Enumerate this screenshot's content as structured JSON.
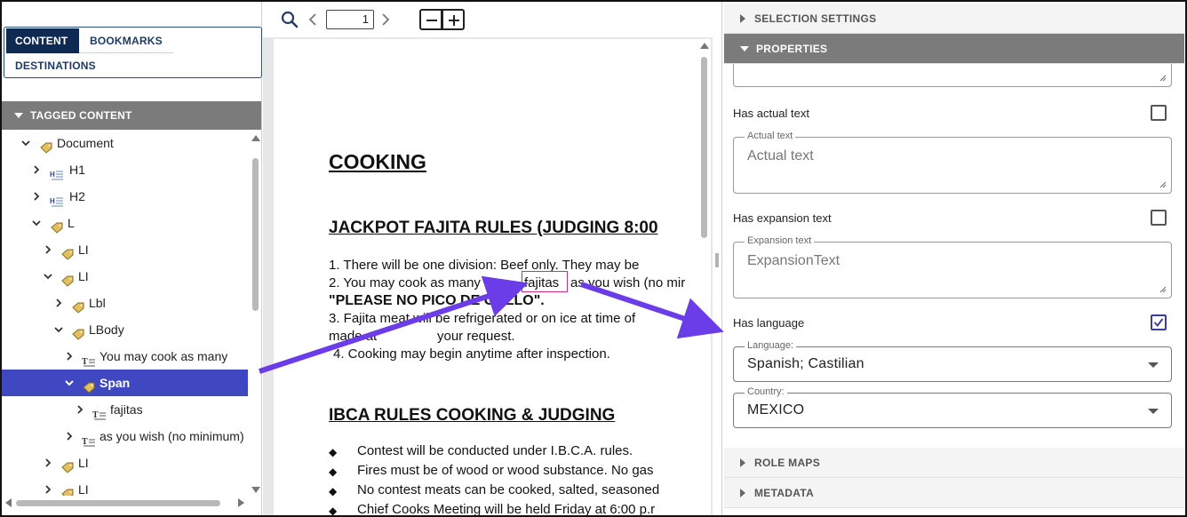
{
  "left_panel": {
    "tabs": [
      {
        "label": "CONTENT",
        "active": true
      },
      {
        "label": "BOOKMARKS",
        "active": false
      },
      {
        "label": "DESTINATIONS",
        "active": false
      }
    ],
    "section_title": "TAGGED CONTENT",
    "tree": [
      {
        "label": "Document",
        "icon": "tag-icon",
        "expanded": true
      },
      {
        "label": "H1",
        "icon": "heading-icon",
        "expanded": false
      },
      {
        "label": "H2",
        "icon": "heading-icon",
        "expanded": false
      },
      {
        "label": "L",
        "icon": "tag-icon",
        "expanded": true
      },
      {
        "label": "LI",
        "icon": "tag-icon",
        "expanded": false
      },
      {
        "label": "LI",
        "icon": "tag-icon",
        "expanded": true
      },
      {
        "label": "Lbl",
        "icon": "tag-icon",
        "expanded": false
      },
      {
        "label": "LBody",
        "icon": "tag-icon",
        "expanded": true
      },
      {
        "label": "You may cook as many",
        "icon": "text-icon",
        "expanded": false
      },
      {
        "label": "Span",
        "icon": "tag-icon",
        "expanded": true,
        "selected": true
      },
      {
        "label": "fajitas",
        "icon": "text-icon",
        "expanded": false
      },
      {
        "label": "as you wish (no minimum)",
        "icon": "text-icon",
        "expanded": false
      },
      {
        "label": "LI",
        "icon": "tag-icon",
        "expanded": false
      },
      {
        "label": "LI",
        "icon": "tag-icon",
        "expanded": false
      }
    ]
  },
  "viewer": {
    "page_number": "1",
    "document": {
      "title": "COOKING",
      "section1_heading": "JACKPOT FAJITA RULES (JUDGING 8:00",
      "line1": "1.    There will be one division: Beef only. They may be",
      "line2a": "2.    You may cook as many",
      "line2_span": "fajitas",
      "line2b": "as you wish (no mir",
      "line3": "\"PLEASE NO PICO DE GALLO\".",
      "line4": "3.    Fajita meat will be refrigerated or on ice at time of",
      "line5a": "made at",
      "line5b": "your request.",
      "line6": "4.   Cooking may begin anytime after inspection.",
      "section2_heading": "IBCA RULES COOKING & JUDGING",
      "bullets": [
        "Contest will be conducted under I.B.C.A. rules.",
        "Fires must be of wood or wood substance.  No gas",
        "No contest meats can be cooked, salted, seasoned",
        "Chief Cooks Meeting will be held Friday at 6:00 p.r"
      ]
    }
  },
  "right_panel": {
    "selection_settings": "SELECTION SETTINGS",
    "properties": "PROPERTIES",
    "has_actual_text": {
      "label": "Has actual text",
      "checked": false
    },
    "actual_text": {
      "legend": "Actual text",
      "placeholder": "Actual text"
    },
    "has_expansion_text": {
      "label": "Has expansion text",
      "checked": false
    },
    "expansion_text": {
      "legend": "Expansion text",
      "placeholder": "ExpansionText"
    },
    "has_language": {
      "label": "Has language",
      "checked": true
    },
    "language": {
      "legend": "Language:",
      "value": "Spanish; Castilian"
    },
    "country": {
      "legend": "Country:",
      "value": "MEXICO"
    },
    "role_maps": "ROLE MAPS",
    "metadata": "METADATA"
  },
  "colors": {
    "selection": "#3f48c0",
    "tab_active": "#0e2a52",
    "section_header": "#7b7b7b",
    "annotation_arrow": "#6a3de8",
    "span_highlight": "#d02a8a"
  }
}
